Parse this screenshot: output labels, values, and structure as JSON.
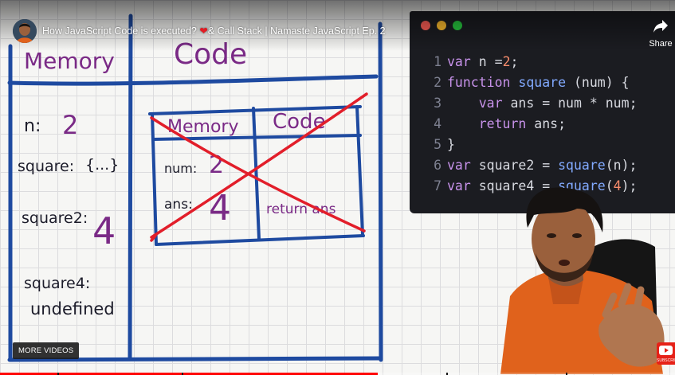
{
  "video": {
    "title": "How JavaScript Code is executed? ",
    "title_emoji": "heart",
    "title_rest": "& Call Stack | Namaste JavaScript Ep. 2",
    "share_label": "Share",
    "more_videos_label": "MORE VIDEOS",
    "subscribe_label": "SUBSCRIBE",
    "progress": 0.56
  },
  "colors": {
    "board_line": "#1e4aa0",
    "ink_purple": "#7a2a86",
    "strike_red": "#e21e2a",
    "progress": "#ff0000",
    "editor_bg": "#1b1c21"
  },
  "board": {
    "memory_header": "Memory",
    "code_header": "Code",
    "memory_entries": [
      {
        "name": "n:",
        "value": "2"
      },
      {
        "name": "square:",
        "value": "{...}"
      },
      {
        "name": "square2:",
        "value": "4"
      },
      {
        "name": "square4:",
        "value": "undefined"
      }
    ],
    "inner_context": {
      "memory_header": "Memory",
      "code_header": "Code",
      "entries": [
        {
          "name": "num:",
          "value": "2"
        },
        {
          "name": "ans:",
          "value": "4"
        }
      ],
      "code_text": "return ans"
    }
  },
  "editor": {
    "window_dots": [
      "#ff5f56",
      "#ffbd2e",
      "#27c93f"
    ],
    "lines": [
      {
        "n": "1",
        "tokens": [
          [
            "kw",
            "var "
          ],
          [
            "id",
            "n "
          ],
          [
            "pn",
            "="
          ],
          [
            "num",
            "2"
          ],
          [
            "pn",
            ";"
          ]
        ]
      },
      {
        "n": "2",
        "tokens": [
          [
            "kw",
            "function "
          ],
          [
            "fn",
            "square "
          ],
          [
            "pn",
            "("
          ],
          [
            "id",
            "num"
          ],
          [
            "pn",
            ") {"
          ]
        ]
      },
      {
        "n": "3",
        "tokens": [
          [
            "pn",
            "    "
          ],
          [
            "kw",
            "var "
          ],
          [
            "id",
            "ans "
          ],
          [
            "pn",
            "= "
          ],
          [
            "id",
            "num "
          ],
          [
            "pn",
            "* "
          ],
          [
            "id",
            "num"
          ],
          [
            "pn",
            ";"
          ]
        ]
      },
      {
        "n": "4",
        "tokens": [
          [
            "pn",
            "    "
          ],
          [
            "kw",
            "return "
          ],
          [
            "id",
            "ans"
          ],
          [
            "pn",
            ";"
          ]
        ]
      },
      {
        "n": "5",
        "tokens": [
          [
            "pn",
            "}"
          ]
        ]
      },
      {
        "n": "6",
        "tokens": [
          [
            "kw",
            "var "
          ],
          [
            "id",
            "square2 "
          ],
          [
            "pn",
            "= "
          ],
          [
            "fn",
            "square"
          ],
          [
            "pn",
            "("
          ],
          [
            "id",
            "n"
          ],
          [
            "pn",
            ");"
          ]
        ]
      },
      {
        "n": "7",
        "tokens": [
          [
            "kw",
            "var "
          ],
          [
            "id",
            "square4 "
          ],
          [
            "pn",
            "= "
          ],
          [
            "fn",
            "square"
          ],
          [
            "pn",
            "("
          ],
          [
            "num",
            "4"
          ],
          [
            "pn",
            ");"
          ]
        ]
      }
    ]
  }
}
